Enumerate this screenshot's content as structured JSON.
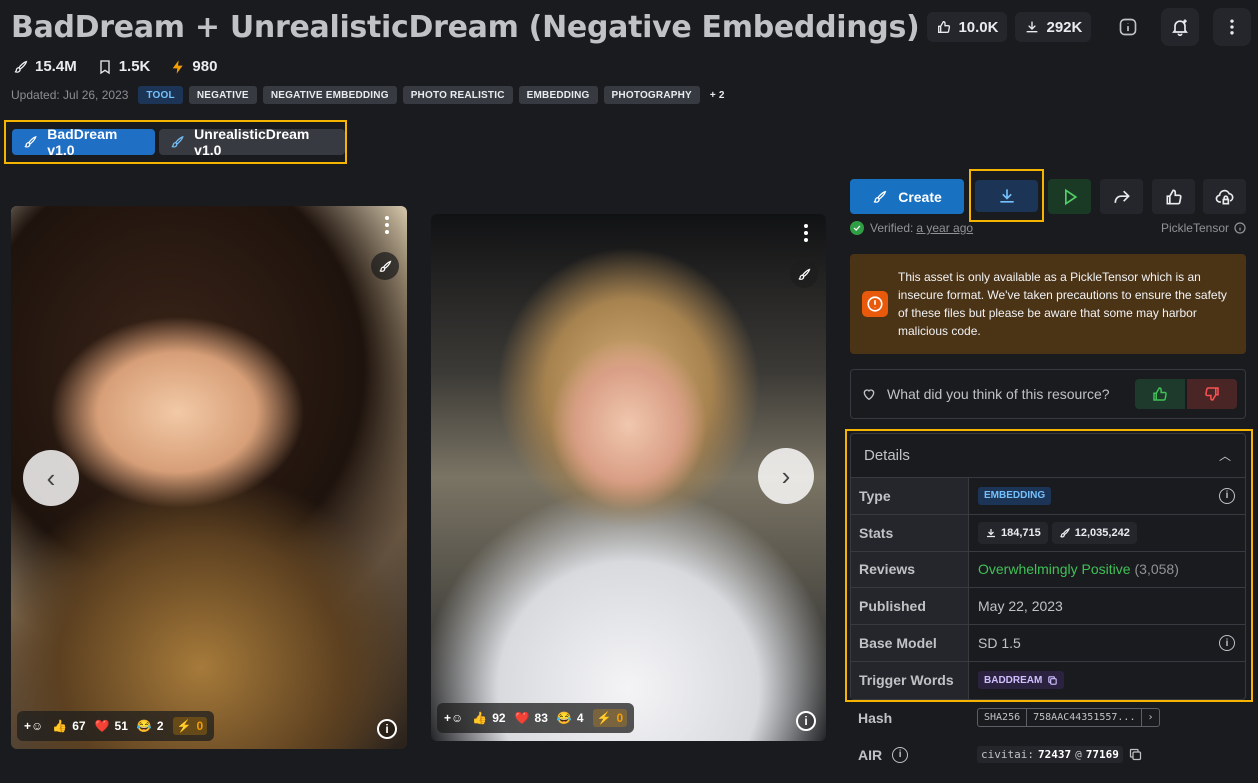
{
  "header": {
    "title": "BadDream + UnrealisticDream (Negative Embeddings)",
    "likes": "10.0K",
    "downloads": "292K"
  },
  "stats": {
    "generations": "15.4M",
    "bookmarks": "1.5K",
    "buzz": "980"
  },
  "updated": "Updated: Jul 26, 2023",
  "tags": [
    "TOOL",
    "NEGATIVE",
    "NEGATIVE EMBEDDING",
    "PHOTO REALISTIC",
    "EMBEDDING",
    "PHOTOGRAPHY",
    "+ 2"
  ],
  "versions": [
    {
      "label": "BadDream v1.0",
      "active": true
    },
    {
      "label": "UnrealisticDream v1.0",
      "active": false
    }
  ],
  "gallery": [
    {
      "reactions": {
        "like": "67",
        "heart": "51",
        "laugh": "2",
        "buzz": "0"
      }
    },
    {
      "reactions": {
        "like": "92",
        "heart": "83",
        "laugh": "4",
        "buzz": "0"
      }
    }
  ],
  "actions": {
    "create_label": "Create"
  },
  "verified": {
    "label": "Verified:",
    "time": "a year ago",
    "format": "PickleTensor"
  },
  "warning": "This asset is only available as a PickleTensor which is an insecure format. We've taken precautions to ensure the safety of these files but please be aware that some may harbor malicious code.",
  "review_prompt": "What did you think of this resource?",
  "details": {
    "heading": "Details",
    "type_label": "Type",
    "type_value": "EMBEDDING",
    "stats_label": "Stats",
    "stats_downloads": "184,715",
    "stats_generations": "12,035,242",
    "reviews_label": "Reviews",
    "reviews_value": "Overwhelmingly Positive",
    "reviews_count": "(3,058)",
    "published_label": "Published",
    "published_value": "May 22, 2023",
    "base_label": "Base Model",
    "base_value": "SD 1.5",
    "trigger_label": "Trigger Words",
    "trigger_value": "BADDREAM",
    "hash_label": "Hash",
    "hash_type": "SHA256",
    "hash_value": "758AAC44351557...",
    "air_label": "AIR",
    "air_prefix": "civitai:",
    "air_model": "72437",
    "air_at": "@",
    "air_version": "77169"
  },
  "colors": {
    "accent": "#1971c2",
    "highlight": "#f5b400",
    "warning_bg": "#4b3316",
    "positive": "#40c057"
  }
}
